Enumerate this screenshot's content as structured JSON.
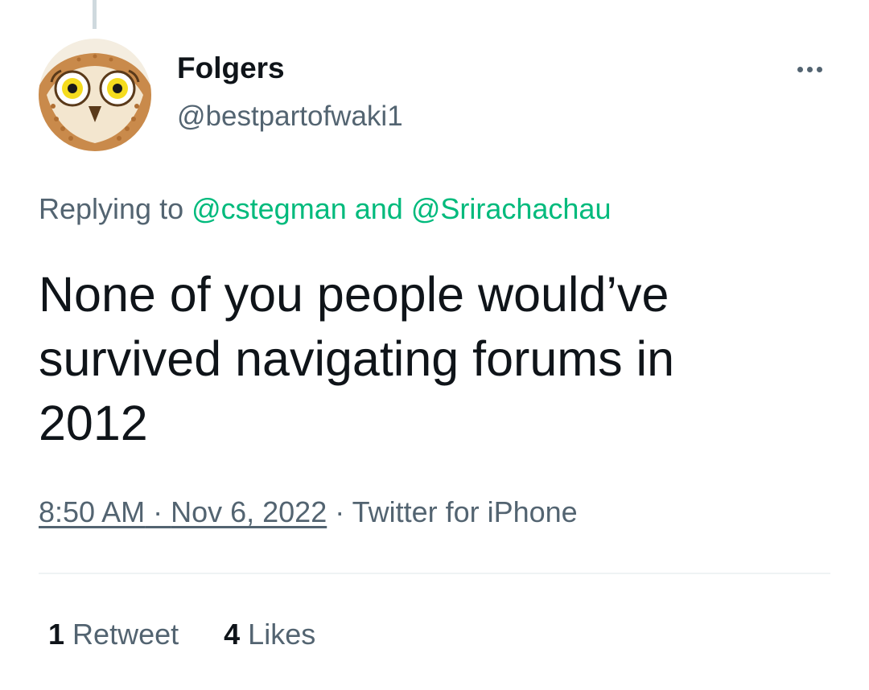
{
  "author": {
    "display_name": "Folgers",
    "handle": "@bestpartofwaki1",
    "avatar_icon": "owl-avatar-icon"
  },
  "more_icon": "more-horizontal-icon",
  "reply_context": {
    "prefix": "Replying to ",
    "users": [
      "@cstegman",
      "@Srirachachau"
    ],
    "joiner": " and "
  },
  "tweet": {
    "text": "None of you people would’ve\nsurvived navigating forums in\n2012"
  },
  "meta": {
    "time": "8:50 AM",
    "separator": " · ",
    "date": "Nov 6, 2022",
    "source": "Twitter for iPhone"
  },
  "stats": {
    "retweets_count": "1",
    "retweets_label": "Retweet",
    "likes_count": "4",
    "likes_label": "Likes"
  },
  "colors": {
    "text_primary": "#0f1419",
    "text_secondary": "#536471",
    "link": "#00ba7c",
    "divider": "#eff3f4"
  }
}
